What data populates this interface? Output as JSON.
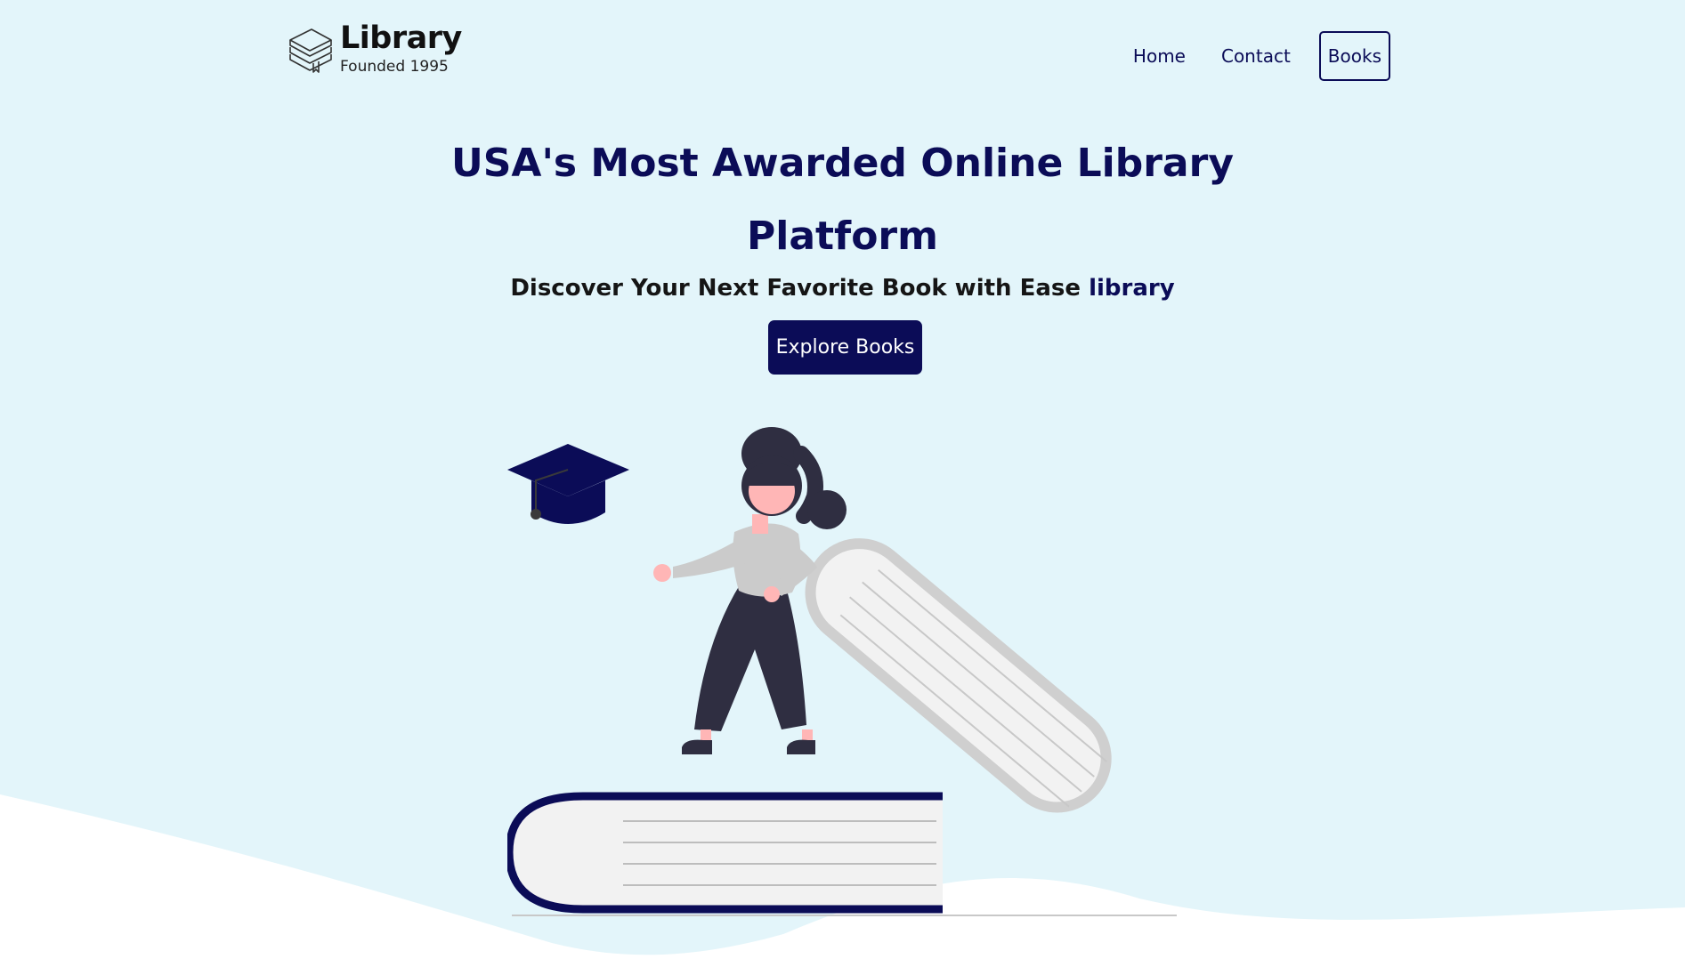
{
  "brand": {
    "title": "Library",
    "subtitle": "Founded 1995",
    "icon": "stacked-books-icon"
  },
  "nav": {
    "items": [
      {
        "label": "Home",
        "name": "nav-home"
      },
      {
        "label": "Contact",
        "name": "nav-contact"
      },
      {
        "label": "Books",
        "name": "nav-books"
      }
    ]
  },
  "hero": {
    "headline_line1": "USA's Most Awarded Online Library",
    "headline_line2": "Platform",
    "subline_text": "Discover Your Next Favorite Book with Ease",
    "subline_accent": "library",
    "cta_label": "Explore Books"
  },
  "colors": {
    "background": "#e3f5fa",
    "navy": "#0b0c57",
    "wave": "#ffffff"
  },
  "illustration": {
    "icon": "woman-on-books-illustration",
    "elements": [
      "graduation-cap-icon",
      "woman-figure",
      "book-stack"
    ]
  }
}
